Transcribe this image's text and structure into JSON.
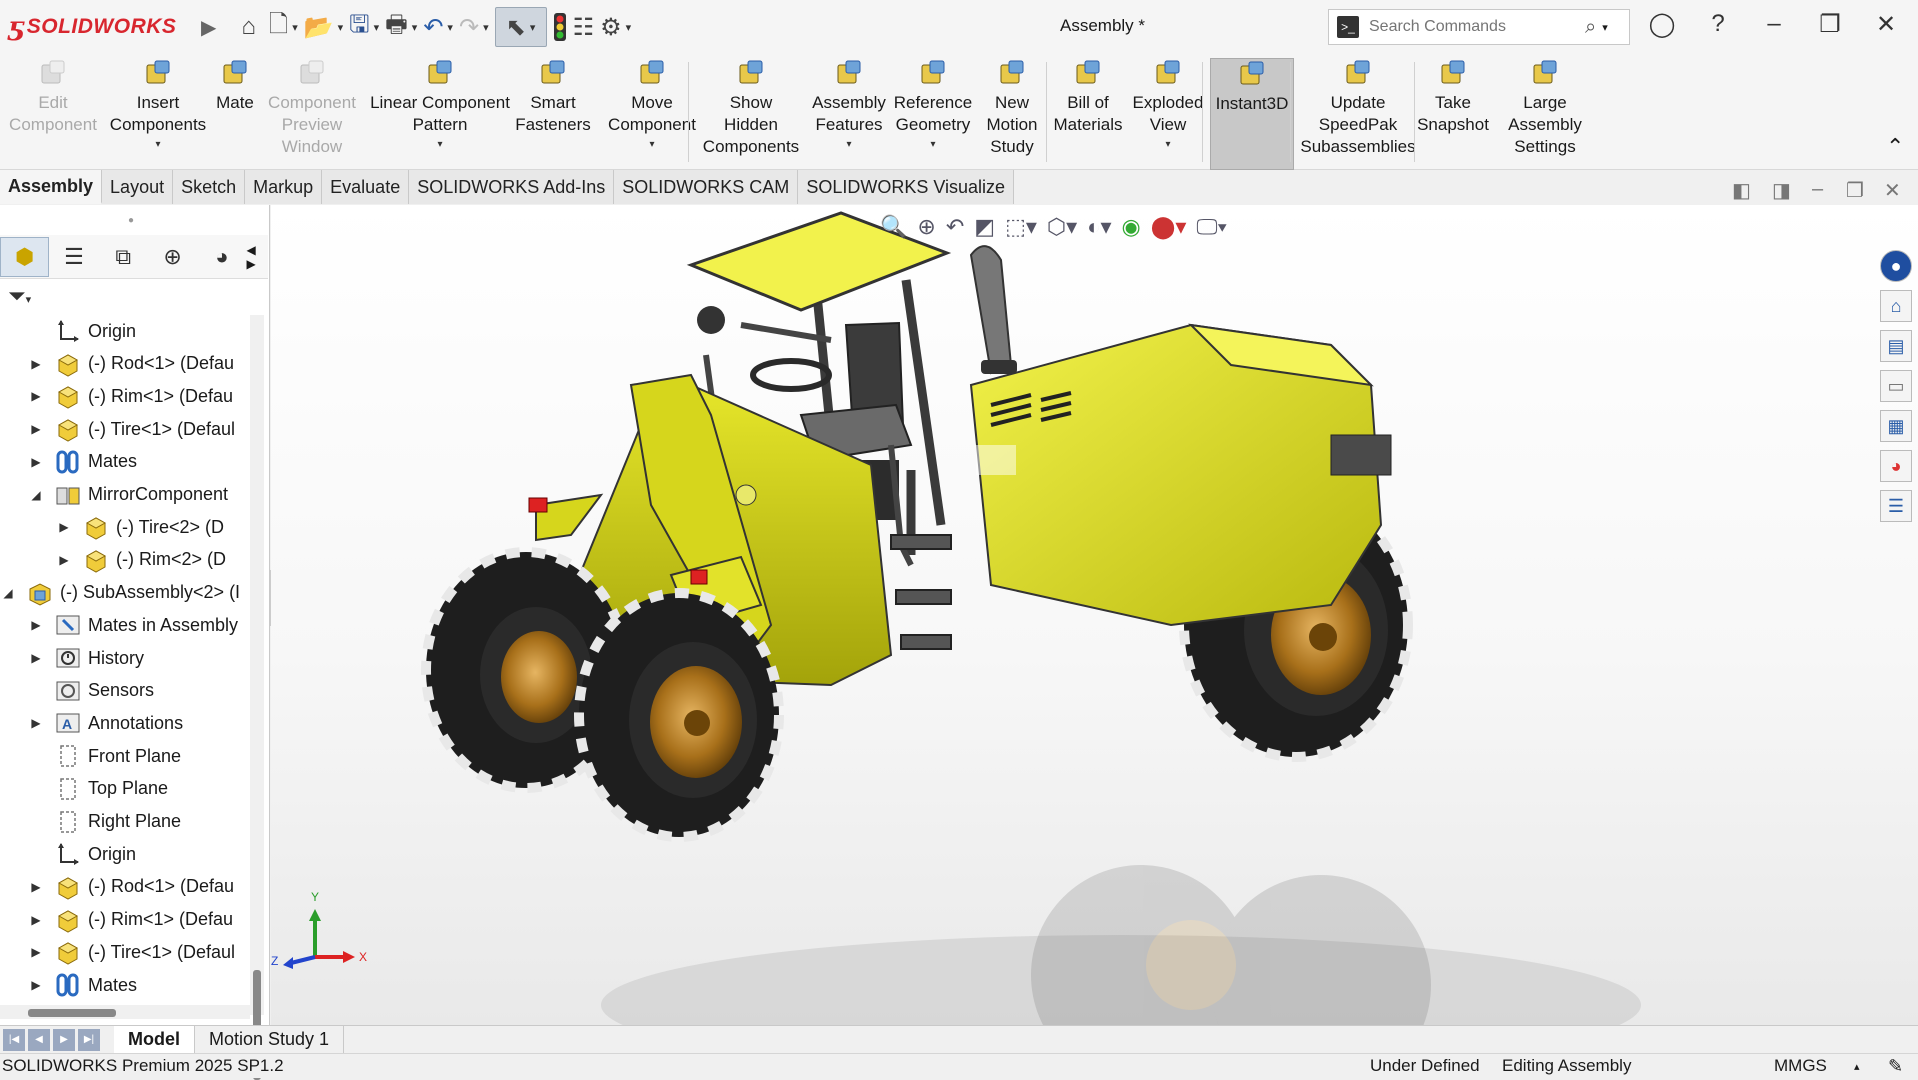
{
  "app": {
    "brand": "SOLIDWORKS",
    "doc_title": "Assembly *",
    "search_placeholder": "Search Commands",
    "colors": {
      "brand_red": "#d8262e",
      "body_yellow": "#e6e61e",
      "tire_black": "#222222",
      "rim_bronze": "#b07a1a"
    }
  },
  "command_manager": [
    {
      "label": "Edit\nComponent",
      "icon": "edit-component-icon",
      "disabled": true
    },
    {
      "label": "Insert\nComponents",
      "icon": "insert-components-icon",
      "dropdown": true
    },
    {
      "label": "Mate",
      "icon": "mate-icon"
    },
    {
      "label": "Component\nPreview\nWindow",
      "icon": "component-preview-icon",
      "disabled": true
    },
    {
      "label": "Linear Component\nPattern",
      "icon": "linear-pattern-icon",
      "dropdown": true
    },
    {
      "label": "Smart\nFasteners",
      "icon": "smart-fasteners-icon"
    },
    {
      "label": "Move\nComponent",
      "icon": "move-component-icon",
      "dropdown": true
    },
    {
      "label": "Show\nHidden\nComponents",
      "icon": "show-hidden-icon"
    },
    {
      "label": "Assembly\nFeatures",
      "icon": "assembly-features-icon",
      "dropdown": true
    },
    {
      "label": "Reference\nGeometry",
      "icon": "reference-geometry-icon",
      "dropdown": true
    },
    {
      "label": "New\nMotion\nStudy",
      "icon": "motion-study-icon"
    },
    {
      "label": "Bill of\nMaterials",
      "icon": "bom-icon"
    },
    {
      "label": "Exploded\nView",
      "icon": "exploded-view-icon",
      "dropdown": true
    },
    {
      "label": "Instant3D",
      "icon": "instant3d-icon",
      "active": true
    },
    {
      "label": "Update\nSpeedPak\nSubassemblies",
      "icon": "speedpak-icon"
    },
    {
      "label": "Take\nSnapshot",
      "icon": "snapshot-icon"
    },
    {
      "label": "Large\nAssembly\nSettings",
      "icon": "large-assembly-icon"
    }
  ],
  "tabs": [
    "Assembly",
    "Layout",
    "Sketch",
    "Markup",
    "Evaluate",
    "SOLIDWORKS Add-Ins",
    "SOLIDWORKS CAM",
    "SOLIDWORKS Visualize"
  ],
  "active_tab": "Assembly",
  "tree": [
    {
      "label": "Origin",
      "indent": 1,
      "icon": "origin-icon",
      "toggle": ""
    },
    {
      "label": "(-) Rod<1> (Defau",
      "indent": 1,
      "icon": "part-icon",
      "toggle": "▶"
    },
    {
      "label": "(-) Rim<1> (Defau",
      "indent": 1,
      "icon": "part-icon",
      "toggle": "▶"
    },
    {
      "label": "(-) Tire<1> (Defaul",
      "indent": 1,
      "icon": "part-icon",
      "toggle": "▶"
    },
    {
      "label": "Mates",
      "indent": 1,
      "icon": "mates-icon",
      "toggle": "▶"
    },
    {
      "label": "MirrorComponent",
      "indent": 1,
      "icon": "mirror-component-icon",
      "toggle": "◢"
    },
    {
      "label": "(-) Tire<2> (D",
      "indent": 2,
      "icon": "part-icon",
      "toggle": "▶"
    },
    {
      "label": "(-) Rim<2> (D",
      "indent": 2,
      "icon": "part-icon",
      "toggle": "▶"
    },
    {
      "label": "(-) SubAssembly<2> (I",
      "indent": 0,
      "icon": "subassembly-icon",
      "toggle": "◢"
    },
    {
      "label": "Mates in Assembly",
      "indent": 1,
      "icon": "mates-in-assembly-icon",
      "toggle": "▶"
    },
    {
      "label": "History",
      "indent": 1,
      "icon": "history-icon",
      "toggle": "▶"
    },
    {
      "label": "Sensors",
      "indent": 1,
      "icon": "sensors-icon",
      "toggle": ""
    },
    {
      "label": "Annotations",
      "indent": 1,
      "icon": "annotations-icon",
      "toggle": "▶"
    },
    {
      "label": "Front Plane",
      "indent": 1,
      "icon": "plane-icon",
      "toggle": ""
    },
    {
      "label": "Top Plane",
      "indent": 1,
      "icon": "plane-icon",
      "toggle": ""
    },
    {
      "label": "Right Plane",
      "indent": 1,
      "icon": "plane-icon",
      "toggle": ""
    },
    {
      "label": "Origin",
      "indent": 1,
      "icon": "origin-icon",
      "toggle": ""
    },
    {
      "label": "(-) Rod<1> (Defau",
      "indent": 1,
      "icon": "part-icon",
      "toggle": "▶"
    },
    {
      "label": "(-) Rim<1> (Defau",
      "indent": 1,
      "icon": "part-icon",
      "toggle": "▶"
    },
    {
      "label": "(-) Tire<1> (Defaul",
      "indent": 1,
      "icon": "part-icon",
      "toggle": "▶"
    },
    {
      "label": "Mates",
      "indent": 1,
      "icon": "mates-icon",
      "toggle": "▶"
    }
  ],
  "triad": {
    "x": "X",
    "y": "Y",
    "z": "Z"
  },
  "bottom_tabs": [
    "Model",
    "Motion Study 1"
  ],
  "active_bottom_tab": "Model",
  "status": {
    "product": "SOLIDWORKS Premium 2025 SP1.2",
    "state": "Under Defined",
    "mode": "Editing Assembly",
    "units": "MMGS"
  }
}
